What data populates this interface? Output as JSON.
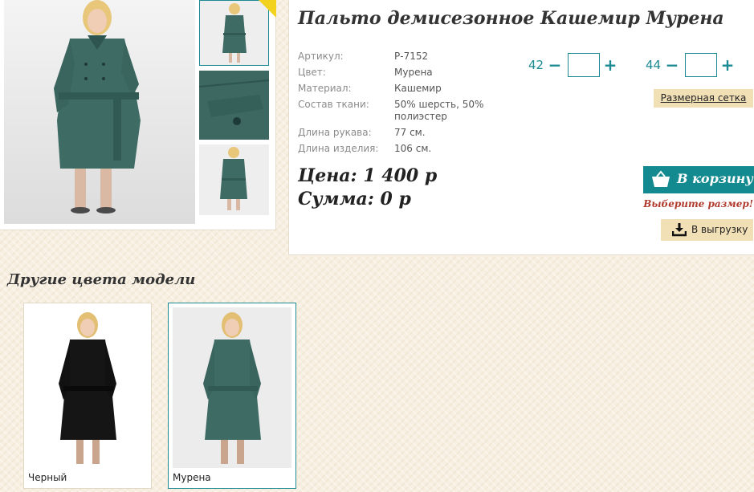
{
  "product": {
    "title": "Пальто демисезонное Кашемир Мурена",
    "specs": [
      {
        "label": "Артикул:",
        "value": "Р-7152"
      },
      {
        "label": "Цвет:",
        "value": "Мурена"
      },
      {
        "label": "Материал:",
        "value": "Кашемир"
      },
      {
        "label": "Состав ткани:",
        "value": "50% шерсть, 50% полиэстер"
      },
      {
        "label": "Длина рукава:",
        "value": "77 см."
      },
      {
        "label": "Длина изделия:",
        "value": "106 см."
      }
    ],
    "price_line": "Цена: 1 400 р",
    "sum_line": "Сумма: 0 р"
  },
  "sizes": [
    {
      "label": "42",
      "minus": "−",
      "plus": "+",
      "value": ""
    },
    {
      "label": "44",
      "minus": "−",
      "plus": "+",
      "value": ""
    }
  ],
  "buttons": {
    "size_chart": "Размерная сетка",
    "add_to_cart": "В корзину",
    "export": "В выгрузку"
  },
  "size_warning": "Выберите размер!",
  "other_colors": {
    "heading": "Другие цвета модели",
    "items": [
      {
        "label": "Черный",
        "coat_color": "#151515"
      },
      {
        "label": "Мурена",
        "coat_color": "#3f6b65"
      }
    ]
  },
  "colors": {
    "accent": "#138a8f",
    "beige_button": "#f1dfb6",
    "warning": "#b03a2e",
    "background": "#f7efe1",
    "coat_main": "#3f6b65"
  },
  "icons": {
    "cart": "basket-icon",
    "export": "download-icon"
  }
}
